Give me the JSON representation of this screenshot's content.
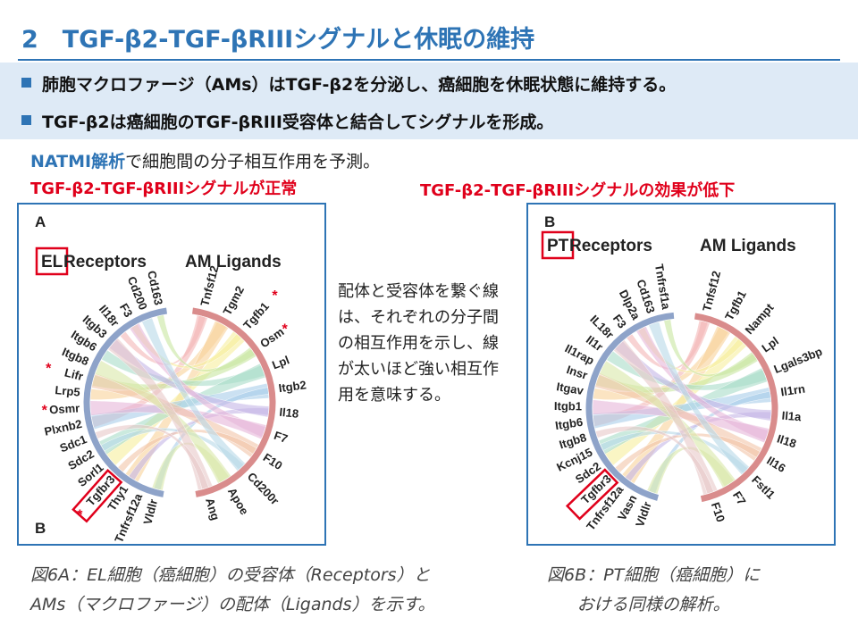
{
  "slide": {
    "title": "2　TGF-β2-TGF-βRIIIシグナルと休眠の維持",
    "bullets": [
      "肺胞マクロファージ（AMs）はTGF-β2を分泌し、癌細胞を休眠状態に維持する。",
      "TGF-β2は癌細胞のTGF-βRIII受容体と結合してシグナルを形成。"
    ],
    "analysis_highlight": "NATMI解析",
    "analysis_rest": "で細胞間の分子相互作用を予測。",
    "left_label": "TGF-β2-TGF-βRIIIシグナルが正常",
    "right_label": "TGF-β2-TGF-βRIIIシグナルの効果が低下",
    "description": "配体と受容体を繋ぐ線は、それぞれの分子間の相互作用を示し、線が太いほど強い相互作用を意味する。",
    "caption_left_1": "図6A：EL細胞（癌細胞）の受容体（Receptors）と",
    "caption_left_2": "AMs（マクロファージ）の配体（Ligands）を示す。",
    "caption_right_1": "図6B：PT細胞（癌細胞）に",
    "caption_right_2": "おける同様の解析。",
    "colors": {
      "accent": "#2e74b5",
      "highlight_red": "#e0001b",
      "bullet_bg": "#deeaf6",
      "receptor_arc": "#8ea3c9",
      "ligand_arc": "#d98c8c"
    }
  },
  "diagrams": [
    {
      "letter": "A",
      "bottom_letter": "B",
      "receptor_prefix": "EL",
      "receptor_word": " Receptors",
      "ligand_header": "AM Ligands",
      "receptors": [
        "Cd163",
        "Cd200",
        "F3",
        "Il18r",
        "Itgb3",
        "Itgb6",
        "Itgb8",
        "Lifr",
        "Lrp5",
        "Osmr",
        "Plxnb2",
        "Sdc1",
        "Sdc2",
        "Sorl1",
        "Tgfbr3",
        "Thy1",
        "Tnfrsf12a",
        "Vldlr"
      ],
      "ligands": [
        "Tnfsf12",
        "Tgm2",
        "Tgfb1",
        "Osm",
        "Lpl",
        "Itgb2",
        "Il18",
        "F7",
        "F10",
        "Cd200r",
        "Apoe",
        "Ang"
      ],
      "asterisk_labels": [
        "Tgfb1",
        "Osm",
        "Lifr",
        "Osmr",
        "Tgfbr3"
      ],
      "boxed_receptor": "Tgfbr3"
    },
    {
      "letter": "B",
      "receptor_prefix": "PT",
      "receptor_word": " Receptors",
      "ligand_header": "AM Ligands",
      "receptors": [
        "Tnfrsf1a",
        "Cd163",
        "Dlp2a",
        "F3",
        "IL18r",
        "Il1r",
        "Il1rap",
        "Insr",
        "Itgav",
        "Itgb1",
        "Itgb6",
        "Itgb8",
        "Kcnj15",
        "Sdc2",
        "Tgfbr3",
        "Tnfrsf12a",
        "Vasn",
        "Vldlr"
      ],
      "ligands": [
        "Tnfsf12",
        "Tgfb1",
        "Nampt",
        "Lpl",
        "Lgals3bp",
        "Il1rn",
        "Il1a",
        "Il18",
        "Il16",
        "Fstl1",
        "F7",
        "F10"
      ],
      "asterisk_labels": [],
      "boxed_receptor": "Tgfbr3"
    }
  ]
}
